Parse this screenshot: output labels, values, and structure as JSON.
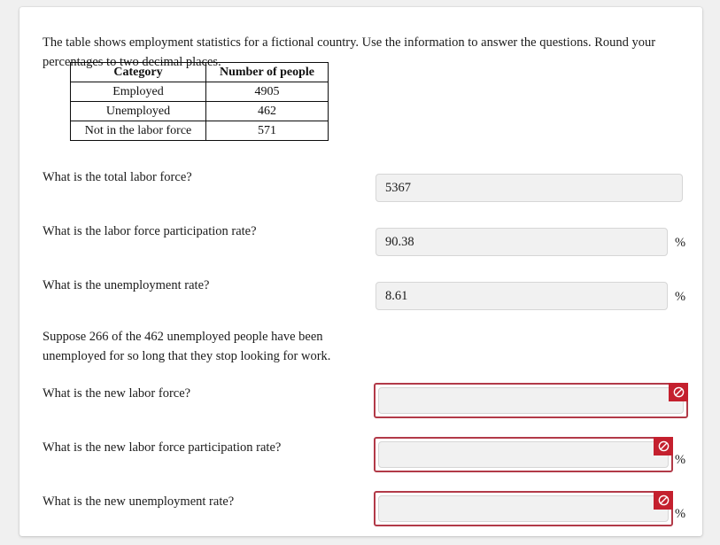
{
  "intro": {
    "text": "The table shows employment statistics for a fictional country. Use the information to answer the questions. Round your percentages to two decimal places."
  },
  "table": {
    "headers": [
      "Category",
      "Number of people"
    ],
    "rows": [
      [
        "Employed",
        "4905"
      ],
      [
        "Unemployed",
        "462"
      ],
      [
        "Not in the labor force",
        "571"
      ]
    ]
  },
  "questions": [
    {
      "label": "What is the total labor force?",
      "value": "5367",
      "placeholder": "",
      "suffix": "",
      "state": "filled"
    },
    {
      "label": "What is the labor force participation rate?",
      "value": "90.38",
      "placeholder": "",
      "suffix": "%",
      "state": "filled"
    },
    {
      "label": "What is the unemployment rate?",
      "value": "8.61",
      "placeholder": "",
      "suffix": "%",
      "state": "filled"
    }
  ],
  "scenario": {
    "text": "Suppose 266 of the 462 unemployed people have been unemployed for so long that they stop looking for work."
  },
  "questions2": [
    {
      "label": "What is the new labor force?",
      "value": "",
      "placeholder": "",
      "suffix": "",
      "state": "error",
      "badge_icon": "prohibition-icon"
    },
    {
      "label": "What is the new labor force participation rate?",
      "value": "",
      "placeholder": "",
      "suffix": "%",
      "state": "error",
      "badge_icon": "prohibition-icon"
    },
    {
      "label": "What is the new unemployment rate?",
      "value": "",
      "placeholder": "",
      "suffix": "%",
      "state": "error",
      "badge_icon": "prohibition-icon"
    }
  ],
  "colors": {
    "page_background": "#f0f0f0",
    "card_background": "#ffffff",
    "text": "#1b1b1b",
    "field_background": "#f1f1f1",
    "field_border": "#d6d6d6",
    "error_border": "#b23a48",
    "error_badge": "#c4202e",
    "table_border": "#0c0c0c"
  }
}
